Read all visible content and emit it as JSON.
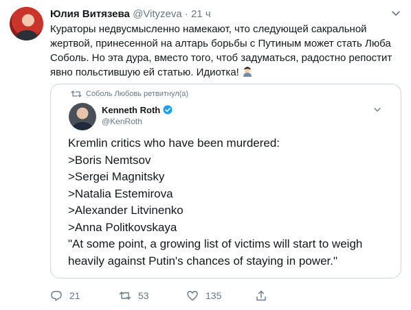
{
  "tweet": {
    "author_name": "Юлия Витязева",
    "author_handle": "@Vityzeva",
    "separator": "·",
    "time": "21 ч",
    "text": "Кураторы недвусмысленно намекают, что следующей сакральной жертвой, принесенной на алтарь борьбы с Путиным может стать Люба Соболь. Но эта дура, вместо того, чтоб задуматься, радостно репостит явно польстившую ей статью. Идиотка!",
    "emoji_icon": "facepalm-emoji",
    "actions": {
      "replies": "21",
      "retweets": "53",
      "likes": "135"
    }
  },
  "quoted": {
    "retweeted_by": "Соболь Любовь ретвитнул(а)",
    "author_name": "Kenneth Roth",
    "author_handle": "@KenRoth",
    "lines": [
      "Kremlin critics who have been murdered:",
      ">Boris Nemtsov",
      ">Sergei Magnitsky",
      ">Natalia Estemirova",
      ">Alexander Litvinenko",
      ">Anna Politkovskaya",
      "\"At some point, a growing list of victims will start to weigh",
      "heavily against Putin's chances of staying in power.\""
    ]
  },
  "colors": {
    "text": "#14171a",
    "muted": "#657786",
    "border": "#ccd6dd",
    "verified": "#1da1f2"
  }
}
